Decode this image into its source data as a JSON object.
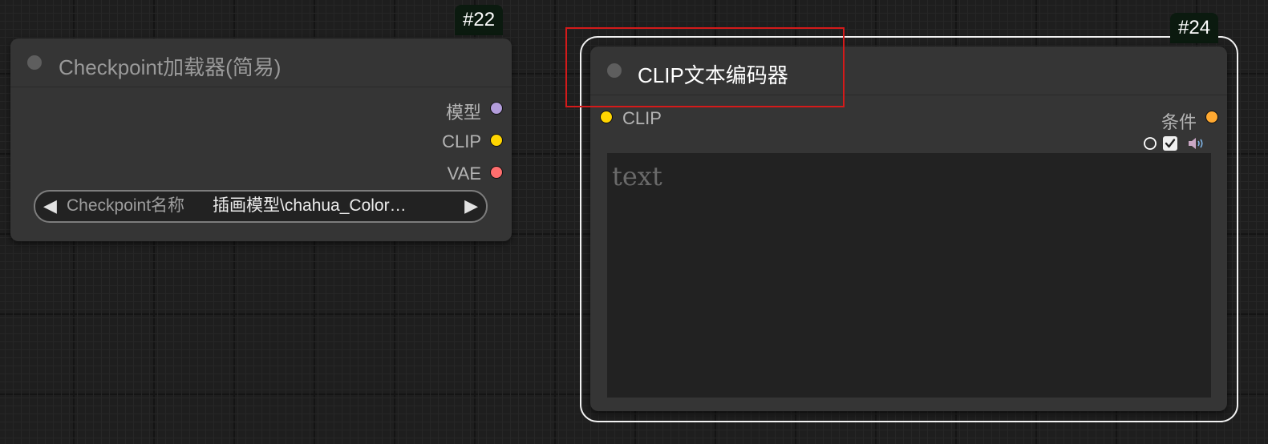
{
  "nodes": {
    "checkpoint_loader": {
      "id_badge": "#22",
      "title": "Checkpoint加载器(简易)",
      "outputs": [
        {
          "label": "模型",
          "color": "#b39ddb"
        },
        {
          "label": "CLIP",
          "color": "#ffd500"
        },
        {
          "label": "VAE",
          "color": "#ff6e6e"
        }
      ],
      "widget": {
        "label": "Checkpoint名称",
        "value": "插画模型\\chahua_Color…",
        "left_arrow": "◀",
        "right_arrow": "▶"
      }
    },
    "clip_text_encoder": {
      "id_badge": "#24",
      "title": "CLIP文本编码器",
      "input": {
        "label": "CLIP",
        "color": "#ffd500"
      },
      "output": {
        "label": "条件",
        "color": "#ffa931"
      },
      "icons": [
        "circle-outline-icon",
        "checkbox-checked-icon",
        "speaker-icon"
      ],
      "textarea": {
        "placeholder": "text",
        "value": ""
      }
    }
  },
  "colors": {
    "canvas_bg": "#1e1e1e",
    "node_bg": "#353535",
    "badge_bg": "#0b1a0f",
    "selection_outline": "#f2f2f2",
    "highlight_box": "#d51a1a"
  }
}
